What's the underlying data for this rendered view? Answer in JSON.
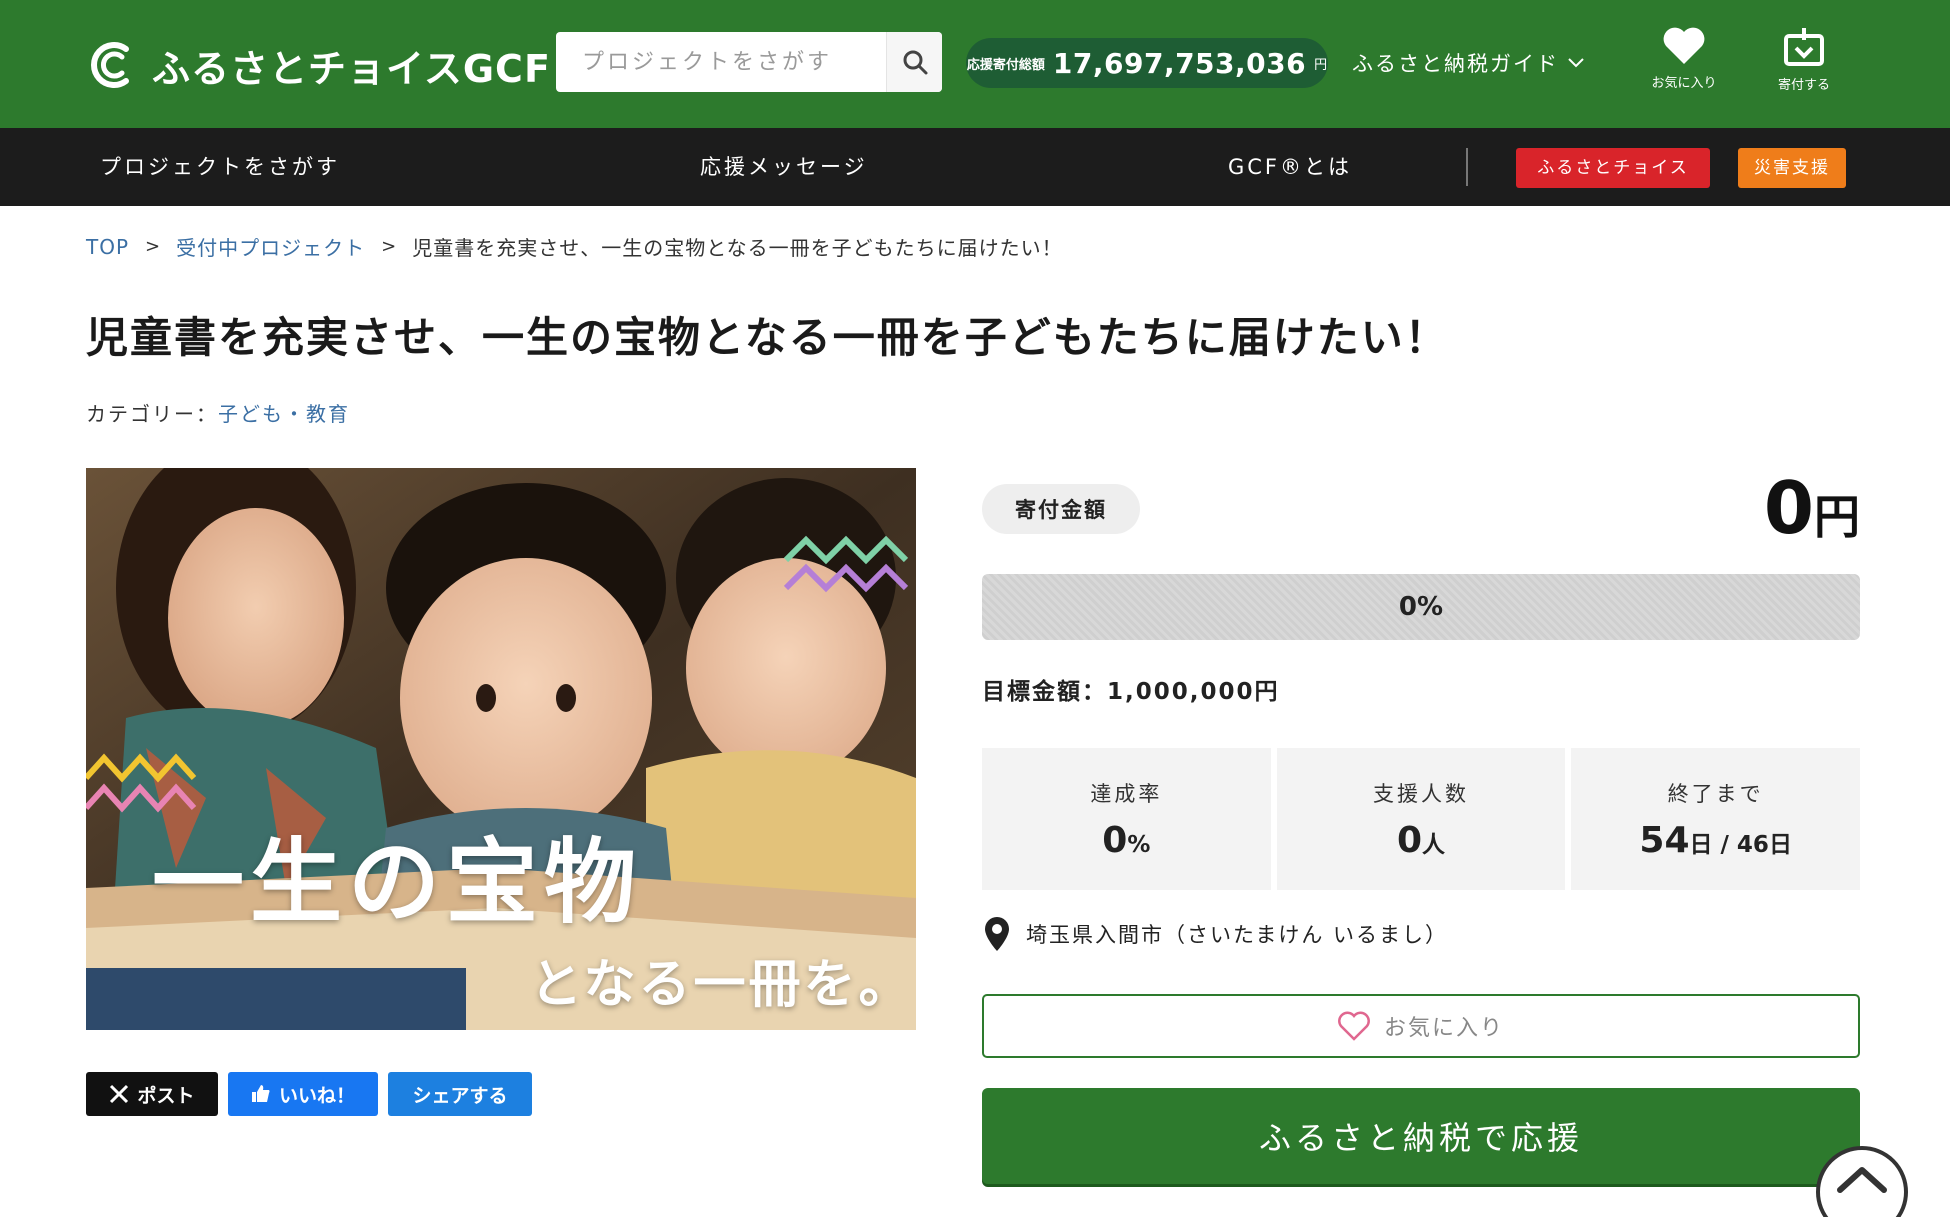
{
  "header": {
    "logo_text": "ふるさとチョイスGCF",
    "search_placeholder": "プロジェクトをさがす",
    "total_label": "応援寄付総額",
    "total_value": "17,697,753,036",
    "total_unit": "円",
    "guide_label": "ふるさと納税ガイド",
    "favorites_label": "お気に入り",
    "donate_label": "寄付する",
    "colors": {
      "brand_green": "#2d7a2d",
      "pill_green": "#1e5d34"
    }
  },
  "subnav": {
    "items": [
      "プロジェクトをさがす",
      "応援メッセージ",
      "GCF®とは"
    ],
    "tag_choice": "ふるさとチョイス",
    "tag_disaster": "災害支援",
    "colors": {
      "choice": "#d9242a",
      "disaster": "#ef7d1a"
    }
  },
  "breadcrumb": {
    "top": "TOP",
    "sep": ">",
    "section": "受付中プロジェクト",
    "current": "児童書を充実させ、一生の宝物となる一冊を子どもたちに届けたい！"
  },
  "project": {
    "title": "児童書を充実させ、一生の宝物となる一冊を子どもたちに届けたい！",
    "category_prefix": "カテゴリー：",
    "category": "子ども・教育",
    "hero_text_1": "一生の宝物",
    "hero_text_2": "となる一冊を。"
  },
  "social": {
    "post": "ポスト",
    "like": "いいね！",
    "share": "シェアする"
  },
  "funding": {
    "amount_label": "寄付金額",
    "amount_value": "0",
    "amount_unit": "円",
    "progress_fraction": 0,
    "progress_text": "0%",
    "goal_text": "目標金額：1,000,000円",
    "stats": {
      "rate_label": "達成率",
      "rate_value": "0",
      "rate_unit": "%",
      "supporters_label": "支援人数",
      "supporters_value": "0",
      "supporters_unit": "人",
      "remaining_label": "終了まで",
      "remaining_value": "54",
      "remaining_unit": "日 / 46日"
    },
    "location": "埼玉県入間市（さいたまけん いるまし）",
    "favorite_button": "お気に入り",
    "support_button": "ふるさと納税で応援"
  }
}
